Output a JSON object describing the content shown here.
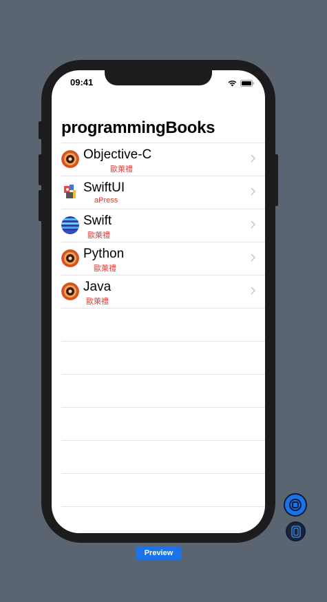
{
  "status_bar": {
    "time": "09:41"
  },
  "nav": {
    "title": "programmingBooks"
  },
  "books": [
    {
      "title": "Objective-C",
      "publisher": "歐萊禮",
      "icon": "orange-gear-icon"
    },
    {
      "title": "SwiftUI",
      "publisher": "aPress",
      "icon": "colorful-character-icon"
    },
    {
      "title": "Swift",
      "publisher": "歐萊禮",
      "icon": "blue-globe-icon"
    },
    {
      "title": "Python",
      "publisher": "歐萊禮",
      "icon": "orange-gear-icon"
    },
    {
      "title": "Java",
      "publisher": "歐萊禮",
      "icon": "orange-gear-icon"
    }
  ],
  "preview": {
    "label": "Preview"
  },
  "colors": {
    "background": "#5b6572",
    "accent": "#1a73e8",
    "publisher": "#e5322c"
  }
}
